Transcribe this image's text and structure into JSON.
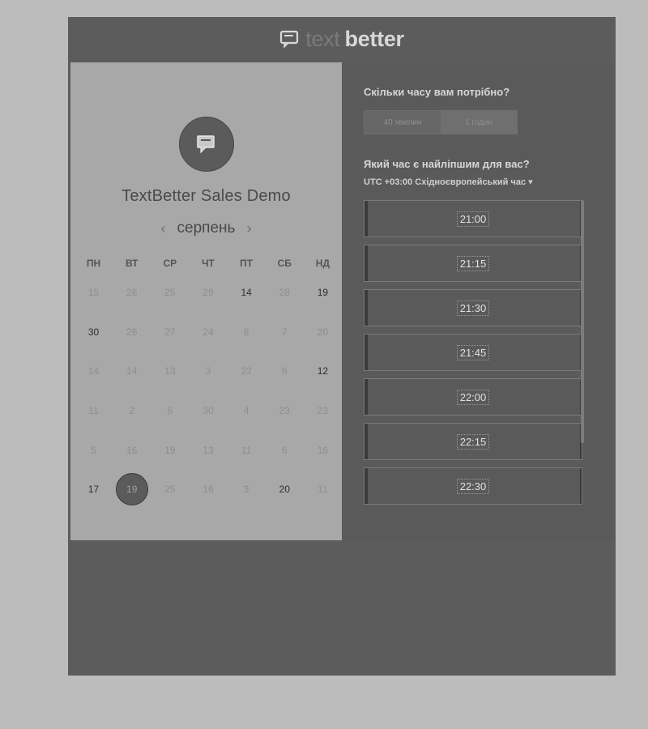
{
  "brand": {
    "light": "text",
    "bold": "better"
  },
  "event": {
    "title": "TextBetter Sales Demo"
  },
  "calendar": {
    "month": "серпень",
    "weekdays": [
      "ПН",
      "ВТ",
      "СР",
      "ЧТ",
      "ПТ",
      "СБ",
      "НД"
    ],
    "weeks": [
      [
        {
          "d": "15"
        },
        {
          "d": "26"
        },
        {
          "d": "25"
        },
        {
          "d": "29"
        },
        {
          "d": "14",
          "a": 1
        },
        {
          "d": "28"
        },
        {
          "d": "19",
          "a": 1
        }
      ],
      [
        {
          "d": "30",
          "a": 1
        },
        {
          "d": "26"
        },
        {
          "d": "27"
        },
        {
          "d": "24"
        },
        {
          "d": "8"
        },
        {
          "d": "7"
        },
        {
          "d": "20"
        }
      ],
      [
        {
          "d": "14"
        },
        {
          "d": "14"
        },
        {
          "d": "13"
        },
        {
          "d": "3"
        },
        {
          "d": "22"
        },
        {
          "d": "6"
        },
        {
          "d": "12",
          "a": 1
        }
      ],
      [
        {
          "d": "11"
        },
        {
          "d": "2"
        },
        {
          "d": "6"
        },
        {
          "d": "30"
        },
        {
          "d": "4"
        },
        {
          "d": "23"
        },
        {
          "d": "23"
        }
      ],
      [
        {
          "d": "5"
        },
        {
          "d": "16"
        },
        {
          "d": "19"
        },
        {
          "d": "13"
        },
        {
          "d": "11"
        },
        {
          "d": "6"
        },
        {
          "d": "16"
        }
      ],
      [
        {
          "d": "17",
          "a": 1
        },
        {
          "d": "19",
          "s": 1
        },
        {
          "d": "25"
        },
        {
          "d": "16"
        },
        {
          "d": "3"
        },
        {
          "d": "20",
          "a": 1
        },
        {
          "d": "11"
        }
      ]
    ]
  },
  "scheduler": {
    "duration_question": "Скільки часу вам потрібно?",
    "durations": [
      {
        "label": "40 хвилин"
      },
      {
        "label": "1 годин",
        "active": true
      }
    ],
    "time_question": "Який час є найліпшим для вас?",
    "timezone": "UTC +03:00 Східноєвропейський час ▾",
    "slots": [
      "21:00",
      "21:15",
      "21:30",
      "21:45",
      "22:00",
      "22:15",
      "22:30"
    ]
  }
}
